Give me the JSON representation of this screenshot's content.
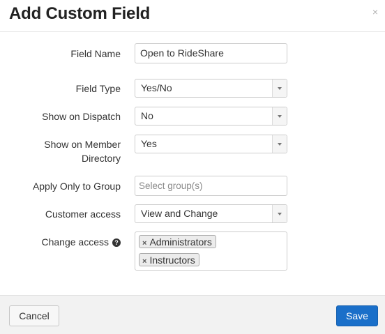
{
  "dialog": {
    "title": "Add Custom Field",
    "close_icon": "×"
  },
  "form": {
    "field_name": {
      "label": "Field Name",
      "value": "Open to RideShare"
    },
    "field_type": {
      "label": "Field Type",
      "value": "Yes/No"
    },
    "show_on_dispatch": {
      "label": "Show on Dispatch",
      "value": "No"
    },
    "show_on_member_directory": {
      "label_line1": "Show on Member",
      "label_line2": "Directory",
      "value": "Yes"
    },
    "apply_only_to_group": {
      "label": "Apply Only to Group",
      "placeholder": "Select group(s)"
    },
    "customer_access": {
      "label": "Customer access",
      "value": "View and Change"
    },
    "change_access": {
      "label": "Change access",
      "help_icon": "?",
      "tags": [
        {
          "remove": "×",
          "label": "Administrators"
        },
        {
          "remove": "×",
          "label": "Instructors"
        }
      ]
    }
  },
  "footer": {
    "cancel_label": "Cancel",
    "save_label": "Save"
  },
  "colors": {
    "primary_button": "#1a6fc9",
    "footer_background": "#f2f2f2"
  }
}
